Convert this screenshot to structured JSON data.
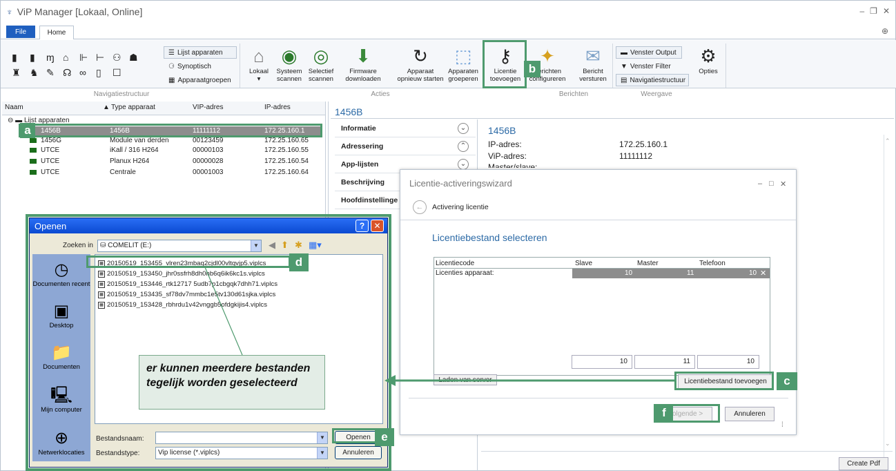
{
  "window": {
    "title": "ViP Manager [Lokaal, Online]"
  },
  "menu": {
    "file": "File",
    "home": "Home"
  },
  "ribbon": {
    "nav_small": [
      "Lijst apparaten",
      "Synoptisch",
      "Apparaatgroepen"
    ],
    "buttons": [
      {
        "label1": "Lokaal",
        "label2": "▾"
      },
      {
        "label1": "Systeem",
        "label2": "scannen"
      },
      {
        "label1": "Selectief",
        "label2": "scannen"
      },
      {
        "label1": "Firmware",
        "label2": "downloaden"
      },
      {
        "label1": "Apparaat",
        "label2": "opnieuw starten"
      },
      {
        "label1": "Apparaten",
        "label2": "groeperen"
      },
      {
        "label1": "Licentie",
        "label2": "toevoegen"
      },
      {
        "label1": "Berichten",
        "label2": "configureren"
      },
      {
        "label1": "Bericht",
        "label2": "versturen"
      }
    ],
    "view_small": [
      "Venster Output",
      "Venster Filter",
      "Navigatiestructuur"
    ],
    "options": "Opties",
    "groups": {
      "nav": "Navigatiestructuur",
      "actions": "Acties",
      "messages": "Berichten",
      "view": "Weergave"
    }
  },
  "device_table": {
    "headers": [
      "Naam",
      "Type apparaat",
      "VIP-adres",
      "IP-adres"
    ],
    "root": "Lijst apparaten",
    "rows": [
      {
        "name": "1456B",
        "type": "1456B",
        "vip": "11111112",
        "ip": "172.25.160.1"
      },
      {
        "name": "1456G",
        "type": "Module van derden",
        "vip": "00123459",
        "ip": "172.25.160.65"
      },
      {
        "name": "UTCE",
        "type": "iKall / 316 H264",
        "vip": "00000103",
        "ip": "172.25.160.55"
      },
      {
        "name": "UTCE",
        "type": "Planux H264",
        "vip": "00000028",
        "ip": "172.25.160.54"
      },
      {
        "name": "UTCE",
        "type": "Centrale",
        "vip": "00001003",
        "ip": "172.25.160.64"
      }
    ]
  },
  "detail": {
    "header": "1456B",
    "tabs": [
      "Informatie",
      "Adressering",
      "App-lijsten",
      "Beschrijving",
      "Hoofdinstellinge"
    ],
    "title": "1456B",
    "fields": [
      {
        "label": "IP-adres:",
        "value": "172.25.160.1"
      },
      {
        "label": "ViP-adres:",
        "value": "11111112"
      },
      {
        "label": "Master/slave:",
        "value": ""
      }
    ],
    "create_pdf": "Create Pdf"
  },
  "wizard": {
    "title": "Licentie-activeringswizard",
    "step": "Activering licentie",
    "heading": "Licentiebestand selecteren",
    "columns": [
      "Licentiecode",
      "Slave",
      "Master",
      "Telefoon"
    ],
    "row": {
      "code": "Licenties apparaat:",
      "slave": "10",
      "master": "11",
      "phone": "10"
    },
    "totals": {
      "slave": "10",
      "master": "11",
      "phone": "10"
    },
    "load_server": "Laden van server",
    "add_file": "Licentiebestand toevoegen",
    "next": "Volgende >",
    "cancel": "Annuleren"
  },
  "open_dialog": {
    "title": "Openen",
    "look_in_label": "Zoeken in",
    "look_in_value": "COMELIT (E:)",
    "places": [
      "Documenten recent",
      "Desktop",
      "Documenten",
      "Mijn computer",
      "Netwerklocaties"
    ],
    "files": [
      "20150519_153455_vlren23mbaq2cjdl00vltqvjp5.viplcs",
      "20150519_153450_jhr0ssfrh8dh0hb6q6ik6kc1s.viplcs",
      "20150519_153446_rtk12717 5udb7p1cbgqk7dhh71.viplcs",
      "20150519_153435_sf78dv7mmbc1e5tv130d61sjka.viplcs",
      "20150519_153428_rbhrdu1v42vnggb5ofdgkijis4.viplcs"
    ],
    "filename_label": "Bestandsnaam:",
    "filename_value": "",
    "filetype_label": "Bestandstype:",
    "filetype_value": "Vip license (*.viplcs)",
    "open_btn": "Openen",
    "cancel_btn": "Annuleren"
  },
  "callout": {
    "text": "er kunnen meerdere bestanden tegelijk worden geselecteerd"
  },
  "markers": {
    "a": "a",
    "b": "b",
    "c": "c",
    "d": "d",
    "e": "e",
    "f": "f"
  }
}
